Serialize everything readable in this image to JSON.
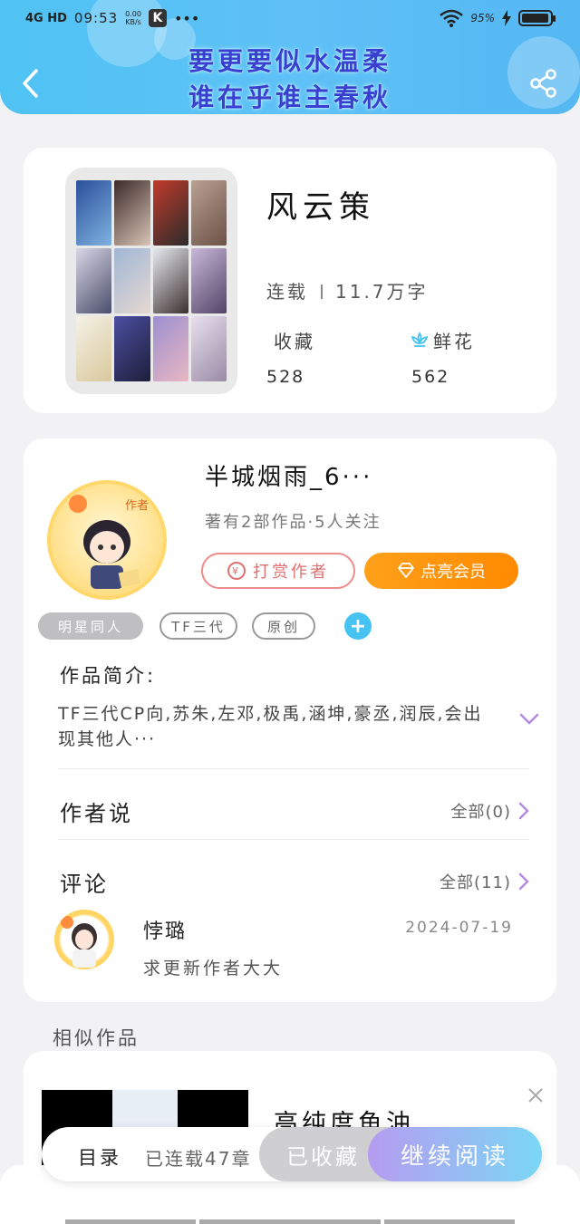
{
  "status_bar": {
    "network": "4G HD",
    "time": "09:53",
    "speed": "0.00",
    "speed_unit": "KB/s",
    "app_badge": "K",
    "battery": "95%"
  },
  "header": {
    "banner_line1": "要更要似水温柔",
    "banner_line2": "谁在乎谁主春秋"
  },
  "book": {
    "title": "风云策",
    "status": "连载",
    "word_count": "11.7万字",
    "favorites_label": "收藏",
    "favorites_value": "528",
    "flowers_label": "鲜花",
    "flowers_value": "562"
  },
  "author": {
    "name": "半城烟雨_6···",
    "badge": "作者",
    "sub": "著有2部作品·5人关注",
    "tip_label": "打赏作者",
    "vip_label": "点亮会员",
    "tags": [
      "明星同人",
      "TF三代",
      "原创"
    ],
    "intro_heading": "作品简介:",
    "intro_text": "TF三代CP向,苏朱,左邓,极禹,涵坤,豪丞,润辰,会出现其他人···",
    "author_says_label": "作者说",
    "author_says_more": "全部(0)",
    "comments_label": "评论",
    "comments_more": "全部(11)"
  },
  "comment": {
    "user": "悖璐",
    "date": "2024-07-19",
    "text": "求更新作者大大"
  },
  "similar": {
    "heading": "相似作品",
    "title": "高纯度鱼油"
  },
  "bottom_bar": {
    "toc_label": "目录",
    "serial_label": "已连载47章",
    "favorited_label": "已收藏",
    "continue_label": "继续阅读"
  },
  "colors": {
    "header": "#56bff4",
    "accent_orange": "#ff8c00",
    "accent_blue": "#47c3f2"
  }
}
